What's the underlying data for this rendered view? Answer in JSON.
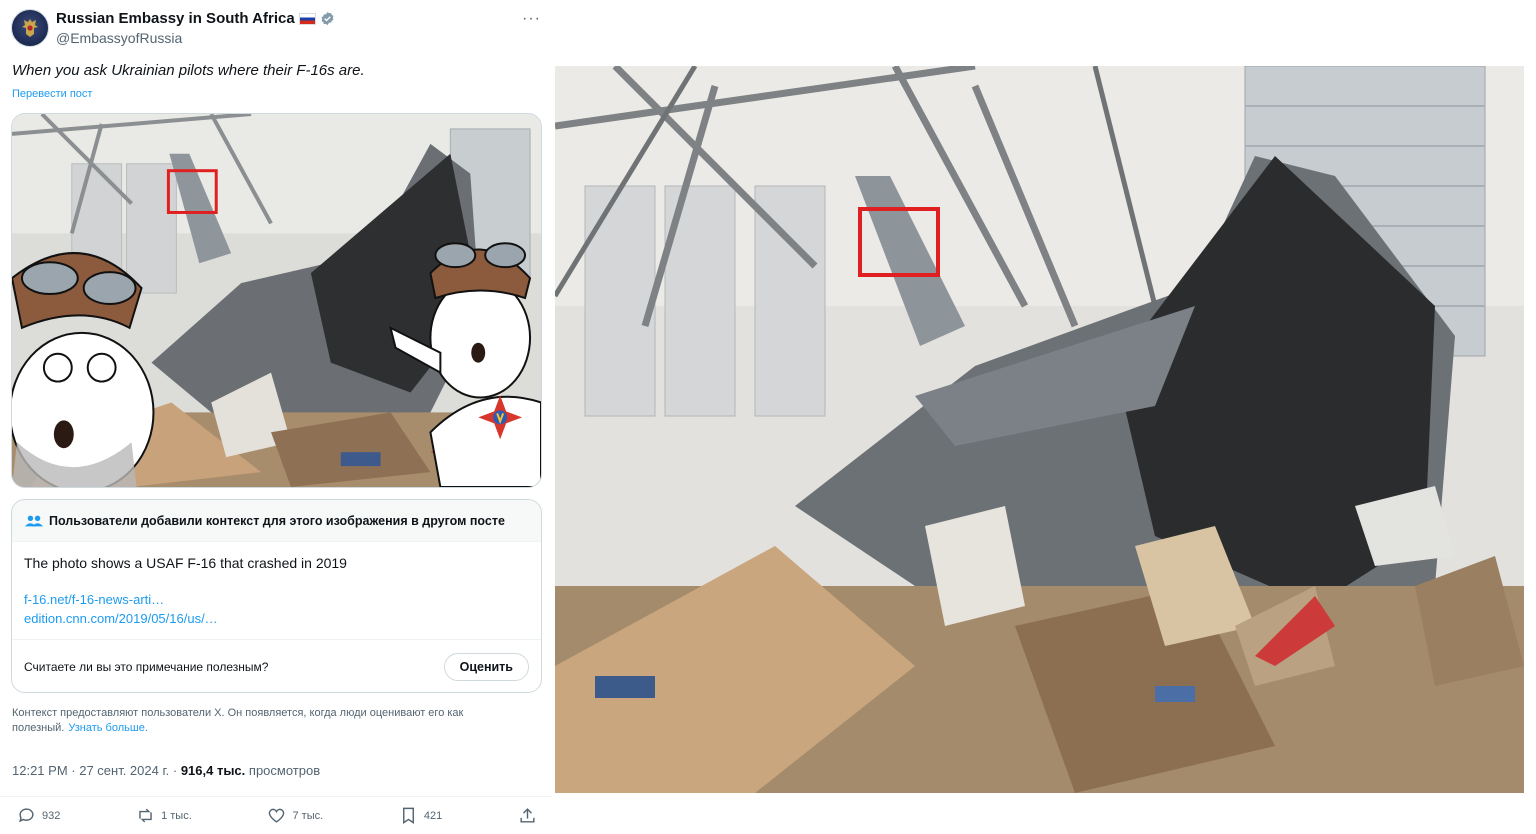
{
  "author": {
    "name": "Russian Embassy in South Africa",
    "handle": "@EmbassyofRussia"
  },
  "tweet": {
    "text": "When you ask Ukrainian pilots where their F-16s are.",
    "translate_label": "Перевести пост",
    "more_label": "···"
  },
  "note": {
    "header": "Пользователи добавили контекст для этого изображения в другом посте",
    "text": "The photo shows a USAF F-16 that crashed in 2019",
    "links": [
      "f-16.net/f-16-news-arti…",
      "edition.cnn.com/2019/05/16/us/…"
    ],
    "question": "Считаете ли вы это примечание полезным?",
    "rate_label": "Оценить"
  },
  "context": {
    "text": "Контекст предоставляют пользователи X. Он появляется, когда люди оценивают его как полезный.",
    "learn_more": "Узнать больше."
  },
  "meta": {
    "time": "12:21 PM",
    "sep": " · ",
    "date": "27 сент. 2024 г.",
    "views": "916,4 тыс.",
    "views_label": "просмотров"
  },
  "actions": {
    "replies": "932",
    "reposts": "1 тыс.",
    "likes": "7 тыс.",
    "bookmarks": "421"
  },
  "colors": {
    "accent": "#1d9bf0",
    "highlight_box": "#e02020"
  }
}
